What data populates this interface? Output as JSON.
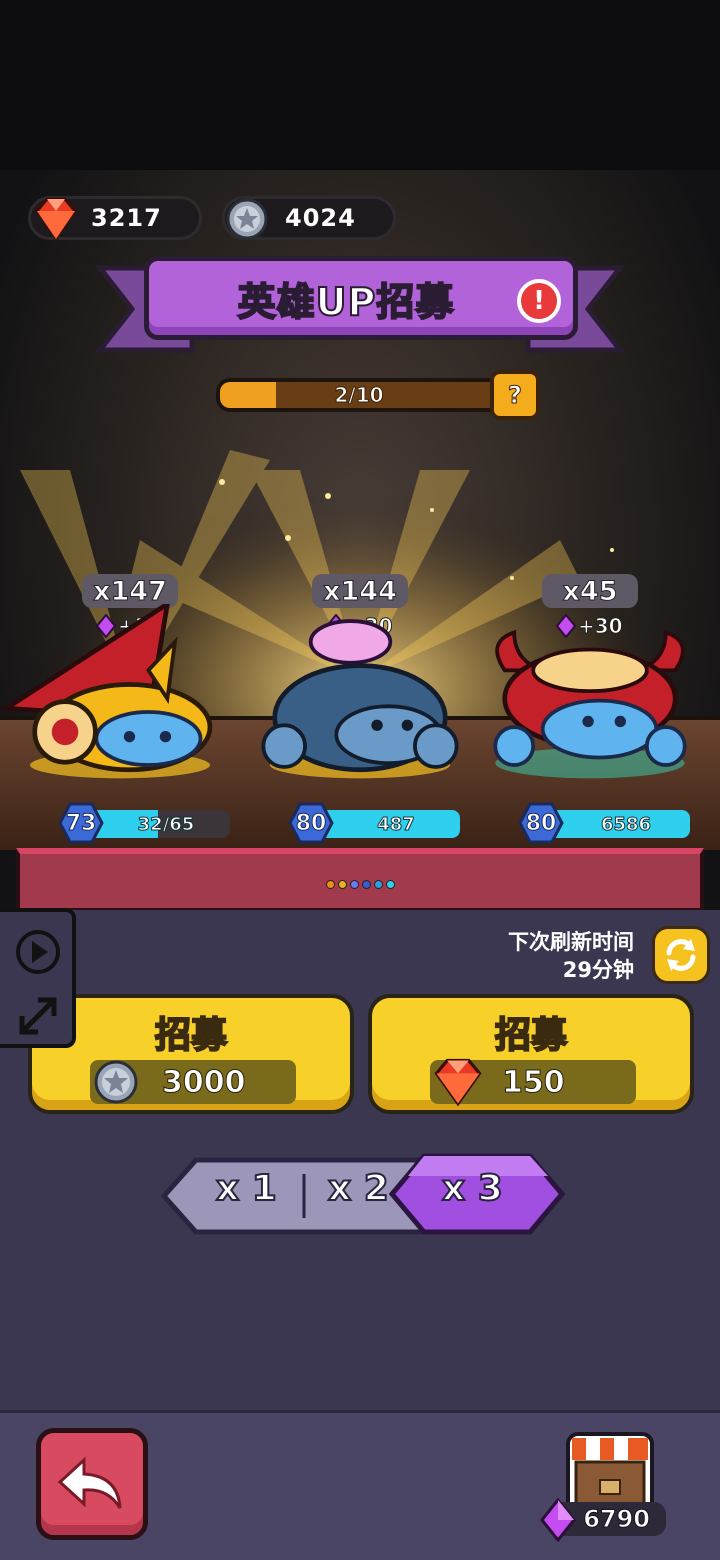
{
  "currencies": {
    "ruby": {
      "value": "3217",
      "icon": "ruby-gem-icon"
    },
    "silver": {
      "value": "4024",
      "icon": "silver-star-coin-icon"
    }
  },
  "banner": {
    "title": "英雄UP招募",
    "alert_icon": "exclamation-icon",
    "alert_symbol": "!"
  },
  "progress": {
    "text": "2/10",
    "current": 2,
    "max": 10,
    "help_symbol": "?"
  },
  "heroes": [
    {
      "count": "x147",
      "bonus": "+30",
      "level": "73",
      "bar_text": "32/65",
      "fill": 0.49,
      "glow": "#f2b21c",
      "body": "#3f8fd6"
    },
    {
      "count": "x144",
      "bonus": "+30",
      "level": "80",
      "bar_text": "487",
      "fill": 1.0,
      "glow": "#f2b21c",
      "body": "#2f5e8c"
    },
    {
      "count": "x45",
      "bonus": "+30",
      "level": "80",
      "bar_text": "6586",
      "fill": 1.0,
      "glow": "#3cc6a8",
      "body": "#3f8fd6"
    }
  ],
  "dots": [
    "#f28a1a",
    "#e8b41c",
    "#6a7cf0",
    "#3a5cd0",
    "#2f9ee0",
    "#2fd0ee"
  ],
  "refresh": {
    "label": "下次刷新时间",
    "time": "29分钟",
    "icon": "refresh-icon"
  },
  "side_tools": {
    "play_icon": "play-icon",
    "expand_icon": "expand-icon"
  },
  "recruit": {
    "silver": {
      "title": "招募",
      "cost": "3000",
      "icon": "silver-star-coin-icon"
    },
    "ruby": {
      "title": "招募",
      "cost": "150",
      "icon": "ruby-gem-icon"
    }
  },
  "multiplier": {
    "options": [
      "x 1",
      "x 2",
      "x 3"
    ],
    "selected": "x 3"
  },
  "bottom": {
    "back_icon": "back-arrow-icon",
    "shop_icon": "shop-stall-icon",
    "gems": "6790"
  },
  "colors": {
    "accent_purple": "#b363da",
    "button_yellow": "#f7d02a",
    "back_red": "#d84a60",
    "hp_cyan": "#2fd0ee"
  }
}
